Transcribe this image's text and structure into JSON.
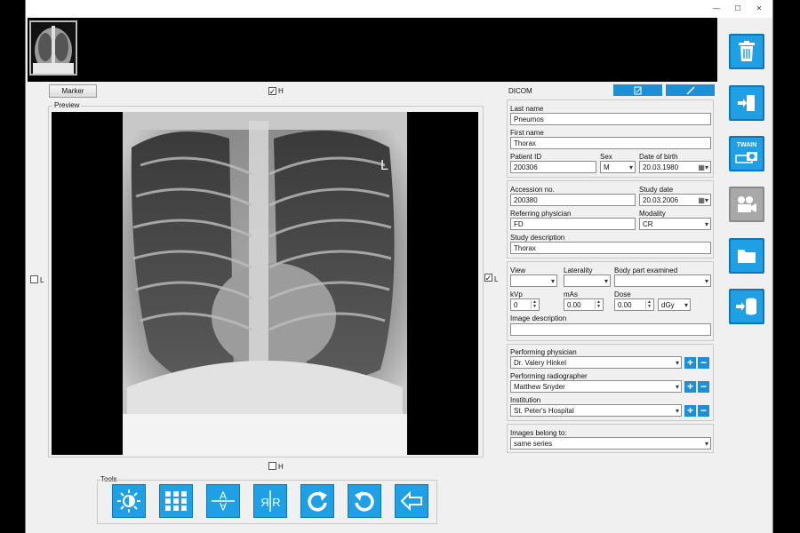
{
  "titlebar": {
    "minimize": "—",
    "maximize": "☐",
    "close": "✕"
  },
  "top": {
    "marker_label": "Marker",
    "h_top": "H",
    "h_bottom": "H",
    "l_left": "L",
    "l_right": "L",
    "preview_label": "Preview"
  },
  "dicom": {
    "header": "DICOM",
    "last_name_label": "Last name",
    "last_name": "Pneumos",
    "first_name_label": "First name",
    "first_name": "Thorax",
    "patient_id_label": "Patient ID",
    "patient_id": "200306",
    "sex_label": "Sex",
    "sex": "M",
    "dob_label": "Date of birth",
    "dob": "20.03.1980",
    "accession_label": "Accession no.",
    "accession": "200380",
    "study_date_label": "Study date",
    "study_date": "20.03.2006",
    "referring_label": "Referring physician",
    "referring": "FD",
    "modality_label": "Modality",
    "modality": "CR",
    "study_desc_label": "Study description",
    "study_desc": "Thorax",
    "view_label": "View",
    "view": "",
    "laterality_label": "Laterality",
    "laterality": "",
    "body_part_label": "Body part examined",
    "body_part": "",
    "kvp_label": "kVp",
    "kvp": "0",
    "mas_label": "mAs",
    "mas": "0.00",
    "dose_label": "Dose",
    "dose": "0.00",
    "dose_unit": "dGy",
    "image_desc_label": "Image description",
    "image_desc": "",
    "perf_phys_label": "Performing physician",
    "perf_phys": "Dr. Valery Hinkel",
    "perf_rad_label": "Performing radiographer",
    "perf_rad": "Matthew Snyder",
    "institution_label": "Institution",
    "institution": "St. Peter's Hospital",
    "belong_label": "Images belong to:",
    "belong": "same series"
  },
  "tools": {
    "label": "Tools"
  },
  "side": {
    "twain_label": "TWAIN"
  },
  "colors": {
    "accent": "#1fa0e4",
    "accent_dark": "#0e76b7"
  }
}
